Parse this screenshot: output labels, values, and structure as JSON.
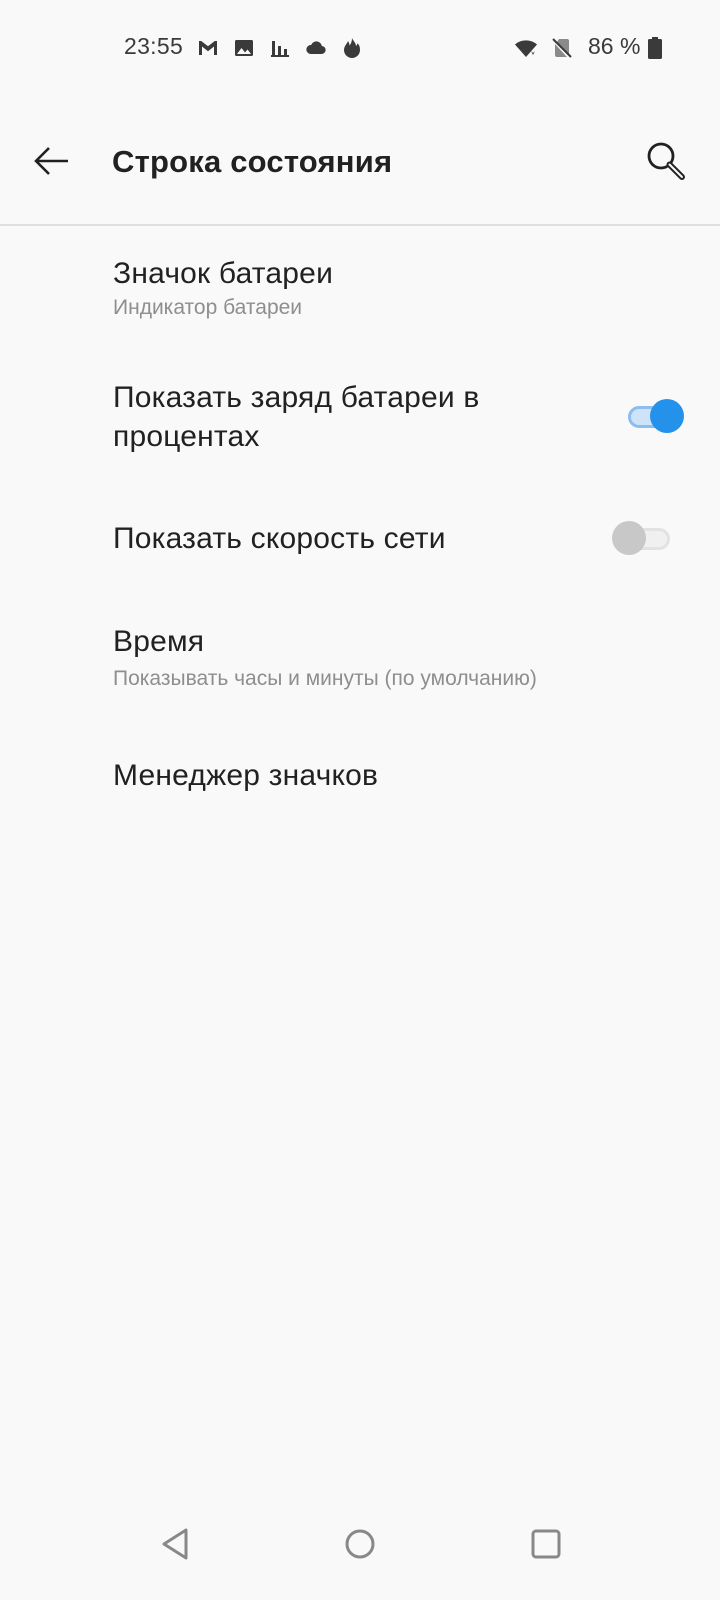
{
  "status_bar": {
    "time": "23:55",
    "notification_icons": [
      "gmail-icon",
      "gallery-icon",
      "stats-icon",
      "cloud-icon",
      "fire-icon"
    ],
    "wifi_icon": "wifi-icon",
    "sim_icon": "no-sim-icon",
    "battery_percent": "86 %",
    "battery_icon": "battery-icon"
  },
  "app_bar": {
    "back_icon": "back-arrow-icon",
    "title": "Строка состояния",
    "search_icon": "search-icon"
  },
  "settings": {
    "battery_icon_item": {
      "title": "Значок батареи",
      "subtitle": "Индикатор батареи"
    },
    "battery_percent_item": {
      "title_line1": "Показать заряд батареи в",
      "title_line2": "процентах",
      "enabled": true
    },
    "network_speed_item": {
      "title": "Показать скорость сети",
      "enabled": false
    },
    "time_item": {
      "title": "Время",
      "subtitle": "Показывать часы и минуты (по умолчанию)"
    },
    "icon_manager_item": {
      "title": "Менеджер значков"
    }
  },
  "nav_bar": {
    "back": "nav-back-icon",
    "home": "nav-home-icon",
    "recents": "nav-recents-icon"
  },
  "colors": {
    "accent": "#2491eb",
    "background": "#f9f9f9",
    "primary_text": "#212121",
    "secondary_text": "#8e8e8e"
  }
}
